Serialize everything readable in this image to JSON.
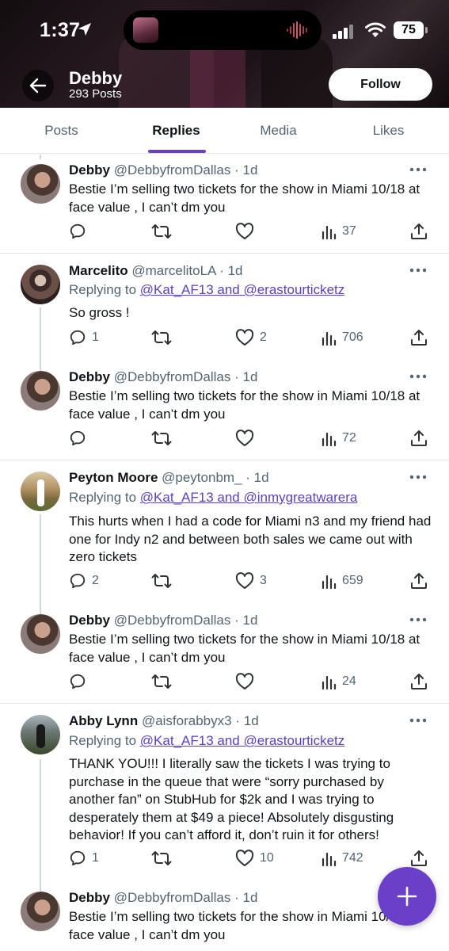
{
  "status_bar": {
    "time": "1:37",
    "battery": "75"
  },
  "profile": {
    "name": "Debby",
    "post_count": "293 Posts",
    "follow_label": "Follow"
  },
  "tabs": [
    {
      "label": "Posts",
      "active": false
    },
    {
      "label": "Replies",
      "active": true
    },
    {
      "label": "Media",
      "active": false
    },
    {
      "label": "Likes",
      "active": false
    }
  ],
  "posts": [
    {
      "name": "Debby",
      "handle": "@DebbyfromDallas",
      "dot": "·",
      "age": "1d",
      "text": "Bestie I’m selling two tickets for the show in Miami 10/18 at face value , I can’t dm you",
      "replies": "",
      "reposts": "",
      "likes": "",
      "views": "37"
    },
    {
      "name": "Marcelito",
      "handle": "@marcelitoLA",
      "dot": "·",
      "age": "1d",
      "replying_prefix": "Replying to ",
      "replying_to": "@Kat_AF13 and @erastourticketz",
      "text": "So gross !",
      "replies": "1",
      "reposts": "",
      "likes": "2",
      "views": "706"
    },
    {
      "name": "Debby",
      "handle": "@DebbyfromDallas",
      "dot": "·",
      "age": "1d",
      "text": "Bestie I’m selling two tickets for the show in Miami 10/18 at face value , I can’t dm you",
      "replies": "",
      "reposts": "",
      "likes": "",
      "views": "72"
    },
    {
      "name": "Peyton Moore",
      "handle": "@peytonbm_",
      "dot": "·",
      "age": "1d",
      "replying_prefix": "Replying to ",
      "replying_to": "@Kat_AF13 and @inmygreatwarera",
      "text": "This hurts when I had a code for Miami n3 and my friend had one for Indy n2 and between both sales we came out with zero tickets",
      "replies": "2",
      "reposts": "",
      "likes": "3",
      "views": "659"
    },
    {
      "name": "Debby",
      "handle": "@DebbyfromDallas",
      "dot": "·",
      "age": "1d",
      "text": "Bestie I’m selling two tickets for the show in Miami 10/18 at face value , I can’t dm you",
      "replies": "",
      "reposts": "",
      "likes": "",
      "views": "24"
    },
    {
      "name": "Abby Lynn",
      "handle": "@aisforabbyx3",
      "dot": "·",
      "age": "1d",
      "replying_prefix": "Replying to ",
      "replying_to": "@Kat_AF13 and @erastourticketz",
      "text": "THANK YOU!!! I literally saw the tickets I was trying to purchase in the queue that were “sorry purchased by another fan” on StubHub for $2k and I was trying to desperately them at $49 a piece! Absolutely disgusting behavior! If you can’t afford it, don’t ruin it for others!",
      "replies": "1",
      "reposts": "",
      "likes": "10",
      "views": "742"
    },
    {
      "name": "Debby",
      "handle": "@DebbyfromDallas",
      "dot": "·",
      "age": "1d",
      "text": "Bestie I’m selling two tickets for the show in Miami 10/18 at face value , I can’t dm you"
    }
  ],
  "colors": {
    "accent": "#6b3fc7",
    "link": "#5b3fc4",
    "muted": "#536471"
  }
}
